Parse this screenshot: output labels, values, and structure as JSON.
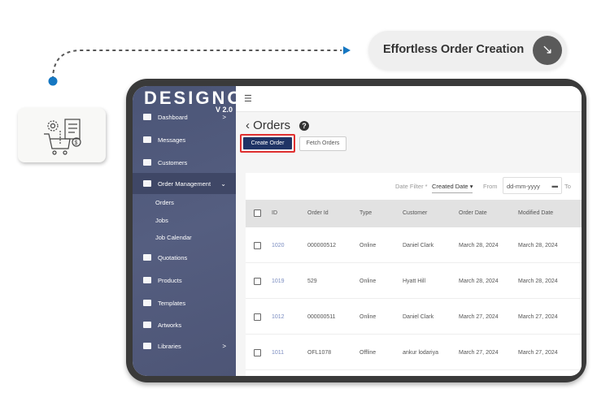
{
  "callout": {
    "label": "Effortless Order Creation",
    "arrow_icon": "arrow-down-right-icon"
  },
  "app": {
    "logo": "DESIGNO",
    "version": "V 2.0"
  },
  "sidebar": {
    "items": [
      {
        "label": "Dashboard",
        "chevron": ">"
      },
      {
        "label": "Messages"
      },
      {
        "label": "Customers"
      },
      {
        "label": "Order Management",
        "chevron": "⌄",
        "active": true
      },
      {
        "label": "Orders",
        "sub": true
      },
      {
        "label": "Jobs",
        "sub": true
      },
      {
        "label": "Job Calendar",
        "sub": true
      },
      {
        "label": "Quotations"
      },
      {
        "label": "Products"
      },
      {
        "label": "Templates"
      },
      {
        "label": "Artworks"
      },
      {
        "label": "Libraries",
        "chevron": ">"
      }
    ]
  },
  "page": {
    "title": "Orders",
    "back": "‹",
    "help": "?",
    "create": "Create Order",
    "fetch": "Fetch Orders"
  },
  "filter": {
    "label": "Date Filter *",
    "selected": "Created Date",
    "from": "From",
    "date_placeholder": "dd-mm-yyyy",
    "to": "To"
  },
  "table": {
    "columns": [
      "ID",
      "Order Id",
      "Type",
      "Customer",
      "Order Date",
      "Modified Date"
    ],
    "rows": [
      [
        "1020",
        "000000512",
        "Online",
        "Daniel Clark",
        "March 28, 2024",
        "March 28, 2024"
      ],
      [
        "1019",
        "529",
        "Online",
        "Hyatt Hill",
        "March 28, 2024",
        "March 28, 2024"
      ],
      [
        "1012",
        "000000511",
        "Online",
        "Daniel Clark",
        "March 27, 2024",
        "March 27, 2024"
      ],
      [
        "1011",
        "OFL1078",
        "Offline",
        "ankur lodariya",
        "March 27, 2024",
        "March 27, 2024"
      ]
    ]
  },
  "colors": {
    "accent": "#1f3466",
    "highlight": "#e03030",
    "dot": "#1577c2",
    "sidebar": "#4f5879"
  }
}
